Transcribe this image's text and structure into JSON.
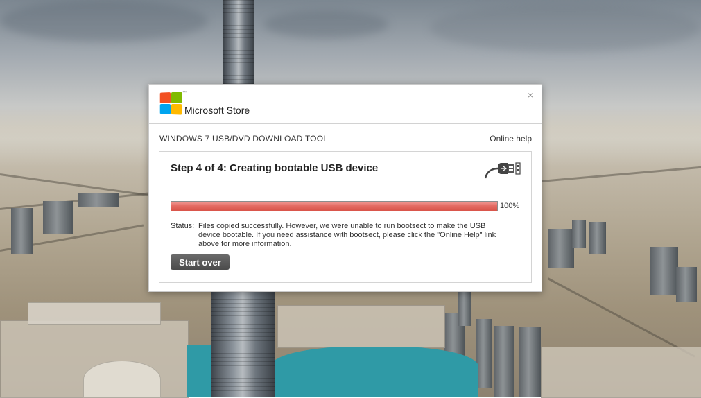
{
  "window": {
    "brand": "Microsoft Store",
    "trademark": "™",
    "minimize_glyph": "–",
    "close_glyph": "×",
    "tool_title": "WINDOWS 7 USB/DVD DOWNLOAD TOOL",
    "online_help": "Online help"
  },
  "step": {
    "title": "Step 4 of 4: Creating bootable USB device",
    "icon": "usb-plug-icon"
  },
  "progress": {
    "value_percent": 100,
    "label": "100%",
    "fill_color": "#e0625a"
  },
  "status": {
    "label": "Status:",
    "message": "Files copied successfully.  However, we were unable to run bootsect to make the USB device bootable.  If you need assistance with bootsect, please click the \"Online Help\" link above for more information."
  },
  "actions": {
    "start_over": "Start over"
  },
  "logo_colors": [
    "#f25022",
    "#7fba00",
    "#00a4ef",
    "#ffb900"
  ]
}
